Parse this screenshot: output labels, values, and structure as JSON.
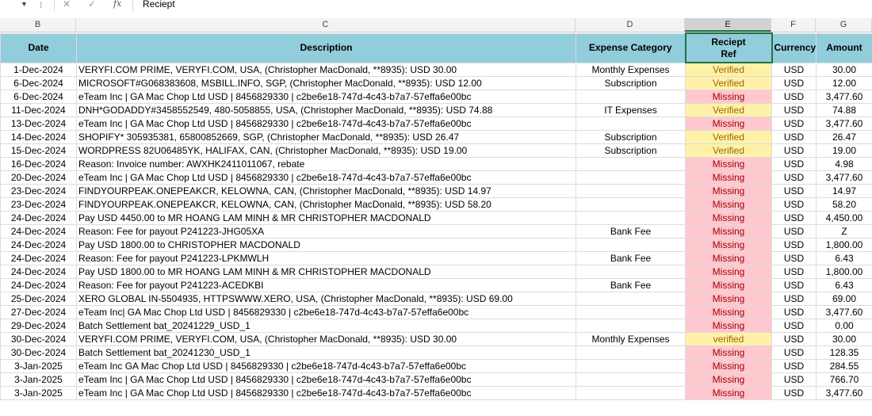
{
  "formula_bar": {
    "formula": "Reciept"
  },
  "columns": [
    "B",
    "C",
    "D",
    "E",
    "F",
    "G"
  ],
  "selected_column": "E",
  "headers": {
    "date": "Date",
    "description": "Description",
    "category": "Expense Category",
    "ref_line1": "Reciept",
    "ref_line2": "Ref",
    "currency": "Currency",
    "amount": "Amount"
  },
  "rows": [
    {
      "date": "1-Dec-2024",
      "desc": "VERYFI.COM PRIME, VERYFI.COM, USA, (Christopher MacDonald, **8935): USD 30.00",
      "cat": "Monthly Expenses",
      "ref": "Verified",
      "cur": "USD",
      "amt": "30.00"
    },
    {
      "date": "6-Dec-2024",
      "desc": "MICROSOFT#G068383608, MSBILL.INFO, SGP, (Christopher MacDonald, **8935): USD 12.00",
      "cat": "Subscription",
      "ref": "Verified",
      "cur": "USD",
      "amt": "12.00"
    },
    {
      "date": "6-Dec-2024",
      "desc": "eTeam Inc | GA Mac Chop Ltd USD | 8456829330 | c2be6e18-747d-4c43-b7a7-57effa6e00bc",
      "cat": "",
      "ref": "Missing",
      "cur": "USD",
      "amt": "3,477.60"
    },
    {
      "date": "11-Dec-2024",
      "desc": "DNH*GODADDY#3458552549, 480-5058855, USA, (Christopher MacDonald, **8935): USD 74.88",
      "cat": "IT Expenses",
      "ref": "Verified",
      "cur": "USD",
      "amt": "74.88"
    },
    {
      "date": "13-Dec-2024",
      "desc": "eTeam Inc | GA Mac Chop Ltd USD | 8456829330 | c2be6e18-747d-4c43-b7a7-57effa6e00bc",
      "cat": "",
      "ref": "Missing",
      "cur": "USD",
      "amt": "3,477.60"
    },
    {
      "date": "14-Dec-2024",
      "desc": "SHOPIFY* 305935381, 65800852669, SGP, (Christopher MacDonald, **8935): USD 26.47",
      "cat": "Subscription",
      "ref": "Verified",
      "cur": "USD",
      "amt": "26.47"
    },
    {
      "date": "15-Dec-2024",
      "desc": "WORDPRESS 82U06485YK, HALIFAX, CAN, (Christopher MacDonald, **8935): USD 19.00",
      "cat": "Subscription",
      "ref": "Verified",
      "cur": "USD",
      "amt": "19.00"
    },
    {
      "date": "16-Dec-2024",
      "desc": "Reason: Invoice number: AWXHK2411011067, rebate",
      "cat": "",
      "ref": "Missing",
      "cur": "USD",
      "amt": "4.98"
    },
    {
      "date": "20-Dec-2024",
      "desc": "eTeam Inc   | GA Mac Chop Ltd USD | 8456829330 | c2be6e18-747d-4c43-b7a7-57effa6e00bc",
      "cat": "",
      "ref": "Missing",
      "cur": "USD",
      "amt": "3,477.60"
    },
    {
      "date": "23-Dec-2024",
      "desc": "FINDYOURPEAK.ONEPEAKCR, KELOWNA, CAN, (Christopher MacDonald, **8935): USD 14.97",
      "cat": "",
      "ref": "Missing",
      "cur": "USD",
      "amt": "14.97"
    },
    {
      "date": "23-Dec-2024",
      "desc": "FINDYOURPEAK.ONEPEAKCR, KELOWNA, CAN, (Christopher MacDonald, **8935): USD 58.20",
      "cat": "",
      "ref": "Missing",
      "cur": "USD",
      "amt": "58.20"
    },
    {
      "date": "24-Dec-2024",
      "desc": "Pay USD 4450.00 to MR HOANG LAM MINH & MR CHRISTOPHER MACDONALD",
      "cat": "",
      "ref": "Missing",
      "cur": "USD",
      "amt": "4,450.00"
    },
    {
      "date": "24-Dec-2024",
      "desc": "Reason: Fee for payout P241223-JHG05XA",
      "cat": "Bank Fee",
      "ref": "Missing",
      "cur": "USD",
      "amt": "Z"
    },
    {
      "date": "24-Dec-2024",
      "desc": "Pay USD 1800.00 to CHRISTOPHER MACDONALD",
      "cat": "",
      "ref": "Missing",
      "cur": "USD",
      "amt": "1,800.00"
    },
    {
      "date": "24-Dec-2024",
      "desc": "Reason: Fee for payout P241223-LPKMWLH",
      "cat": "Bank Fee",
      "ref": "Missing",
      "cur": "USD",
      "amt": "6.43"
    },
    {
      "date": "24-Dec-2024",
      "desc": "Pay USD 1800.00 to MR HOANG LAM MINH & MR CHRISTOPHER MACDONALD",
      "cat": "",
      "ref": "Missing",
      "cur": "USD",
      "amt": "1,800.00"
    },
    {
      "date": "24-Dec-2024",
      "desc": "Reason: Fee for payout P241223-ACEDKBI",
      "cat": "Bank Fee",
      "ref": "Missing",
      "cur": "USD",
      "amt": "6.43"
    },
    {
      "date": "25-Dec-2024",
      "desc": "XERO GLOBAL IN-5504935, HTTPSWWW.XERO, USA, (Christopher MacDonald, **8935): USD 69.00",
      "cat": "",
      "ref": "Missing",
      "cur": "USD",
      "amt": "69.00"
    },
    {
      "date": "27-Dec-2024",
      "desc": "eTeam Inc| GA Mac Chop Ltd USD | 8456829330 | c2be6e18-747d-4c43-b7a7-57effa6e00bc",
      "cat": "",
      "ref": "Missing",
      "cur": "USD",
      "amt": "3,477.60"
    },
    {
      "date": "29-Dec-2024",
      "desc": "Batch Settlement bat_20241229_USD_1",
      "cat": "",
      "ref": "Missing",
      "cur": "USD",
      "amt": "0.00"
    },
    {
      "date": "30-Dec-2024",
      "desc": "VERYFI.COM PRIME, VERYFI.COM, USA, (Christopher MacDonald, **8935): USD 30.00",
      "cat": "Monthly Expenses",
      "ref": "verified",
      "cur": "USD",
      "amt": "30.00"
    },
    {
      "date": "30-Dec-2024",
      "desc": "Batch Settlement bat_20241230_USD_1",
      "cat": "",
      "ref": "Missing",
      "cur": "USD",
      "amt": "128.35"
    },
    {
      "date": "3-Jan-2025",
      "desc": "eTeam Inc GA Mac Chop Ltd USD | 8456829330 | c2be6e18-747d-4c43-b7a7-57effa6e00bc",
      "cat": "",
      "ref": "Missing",
      "cur": "USD",
      "amt": "284.55"
    },
    {
      "date": "3-Jan-2025",
      "desc": "eTeam Inc        | GA Mac Chop Ltd USD | 8456829330 | c2be6e18-747d-4c43-b7a7-57effa6e00bc",
      "cat": "",
      "ref": "Missing",
      "cur": "USD",
      "amt": "766.70"
    },
    {
      "date": "3-Jan-2025",
      "desc": "eTeam Inc        | GA Mac Chop Ltd USD | 8456829330 | c2be6e18-747d-4c43-b7a7-57effa6e00bc",
      "cat": "",
      "ref": "Missing",
      "cur": "USD",
      "amt": "3,477.60"
    }
  ]
}
